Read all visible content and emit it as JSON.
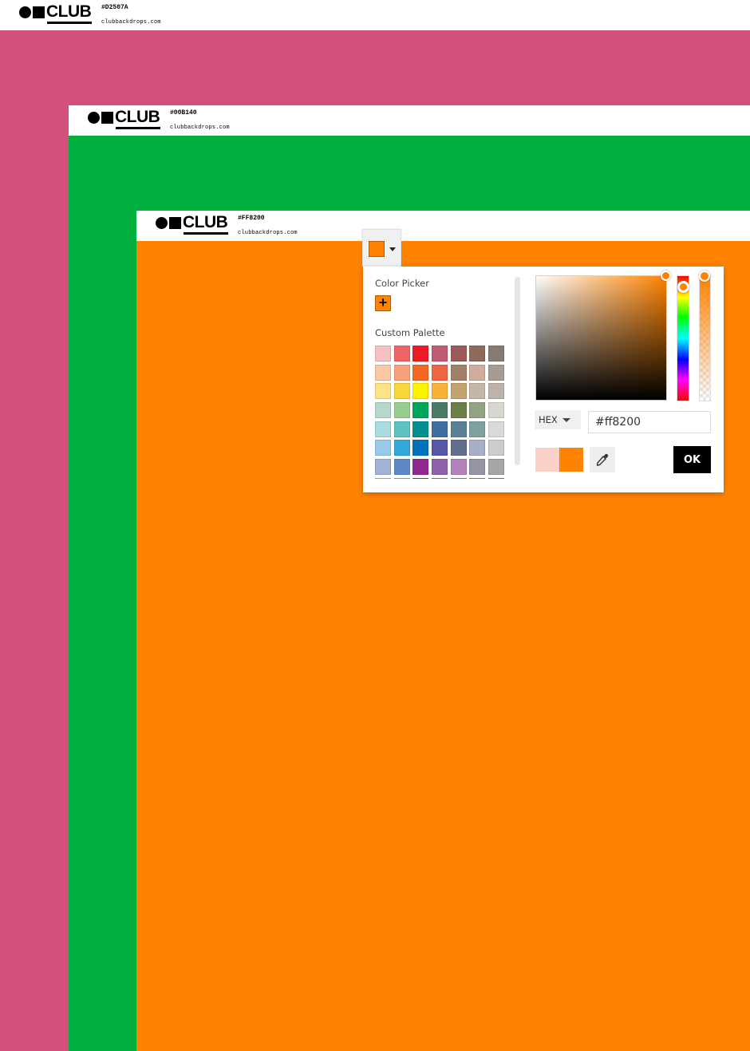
{
  "layers": [
    {
      "hex_label": "#D2507A",
      "site": "clubbackdrops.com",
      "logo_text": "CLUB",
      "color": "#D2507A"
    },
    {
      "hex_label": "#00B140",
      "site": "clubbackdrops.com",
      "logo_text": "CLUB",
      "color": "#00B140"
    },
    {
      "hex_label": "#FF8200",
      "site": "clubbackdrops.com",
      "logo_text": "CLUB",
      "color": "#FF8200"
    }
  ],
  "picker": {
    "trigger_color": "#ff8200",
    "color_picker_title": "Color Picker",
    "add_symbol": "+",
    "palette_title": "Custom Palette",
    "palette": [
      "#f5c2c2",
      "#ef6566",
      "#ed1c24",
      "#c25b72",
      "#9e5a5a",
      "#8e6a5d",
      "#877a70",
      "#fbc8a4",
      "#f7a17e",
      "#f26722",
      "#ef6645",
      "#a08067",
      "#d1ac9b",
      "#a69c93",
      "#fce383",
      "#f9d63b",
      "#fff200",
      "#f8b13a",
      "#c4a373",
      "#c3b7a8",
      "#bcb3aa",
      "#b4d9cb",
      "#98cd8e",
      "#00a55c",
      "#4a7b64",
      "#6c7f46",
      "#92a385",
      "#d8d6ce",
      "#a8dcde",
      "#5ec2c2",
      "#00918e",
      "#3d6fa0",
      "#5b8094",
      "#7ea19f",
      "#d9d9d9",
      "#97c9e8",
      "#32a8dc",
      "#0072bc",
      "#5558a8",
      "#62708e",
      "#a7b1c6",
      "#cccccc",
      "#a3b1d7",
      "#5d8ac7",
      "#92278f",
      "#8e62a9",
      "#b382ba",
      "#9494a4",
      "#a6a6a6",
      "#c5a6d1",
      "#ee7fb4",
      "#ec008c",
      "#e6508a",
      "#c7629a",
      "#868686",
      "#7a7a7a"
    ],
    "current_color": "#ff8200",
    "previous_color": "#fbd0c8",
    "format": "HEX",
    "hex_value": "#ff8200",
    "ok_label": "OK"
  }
}
